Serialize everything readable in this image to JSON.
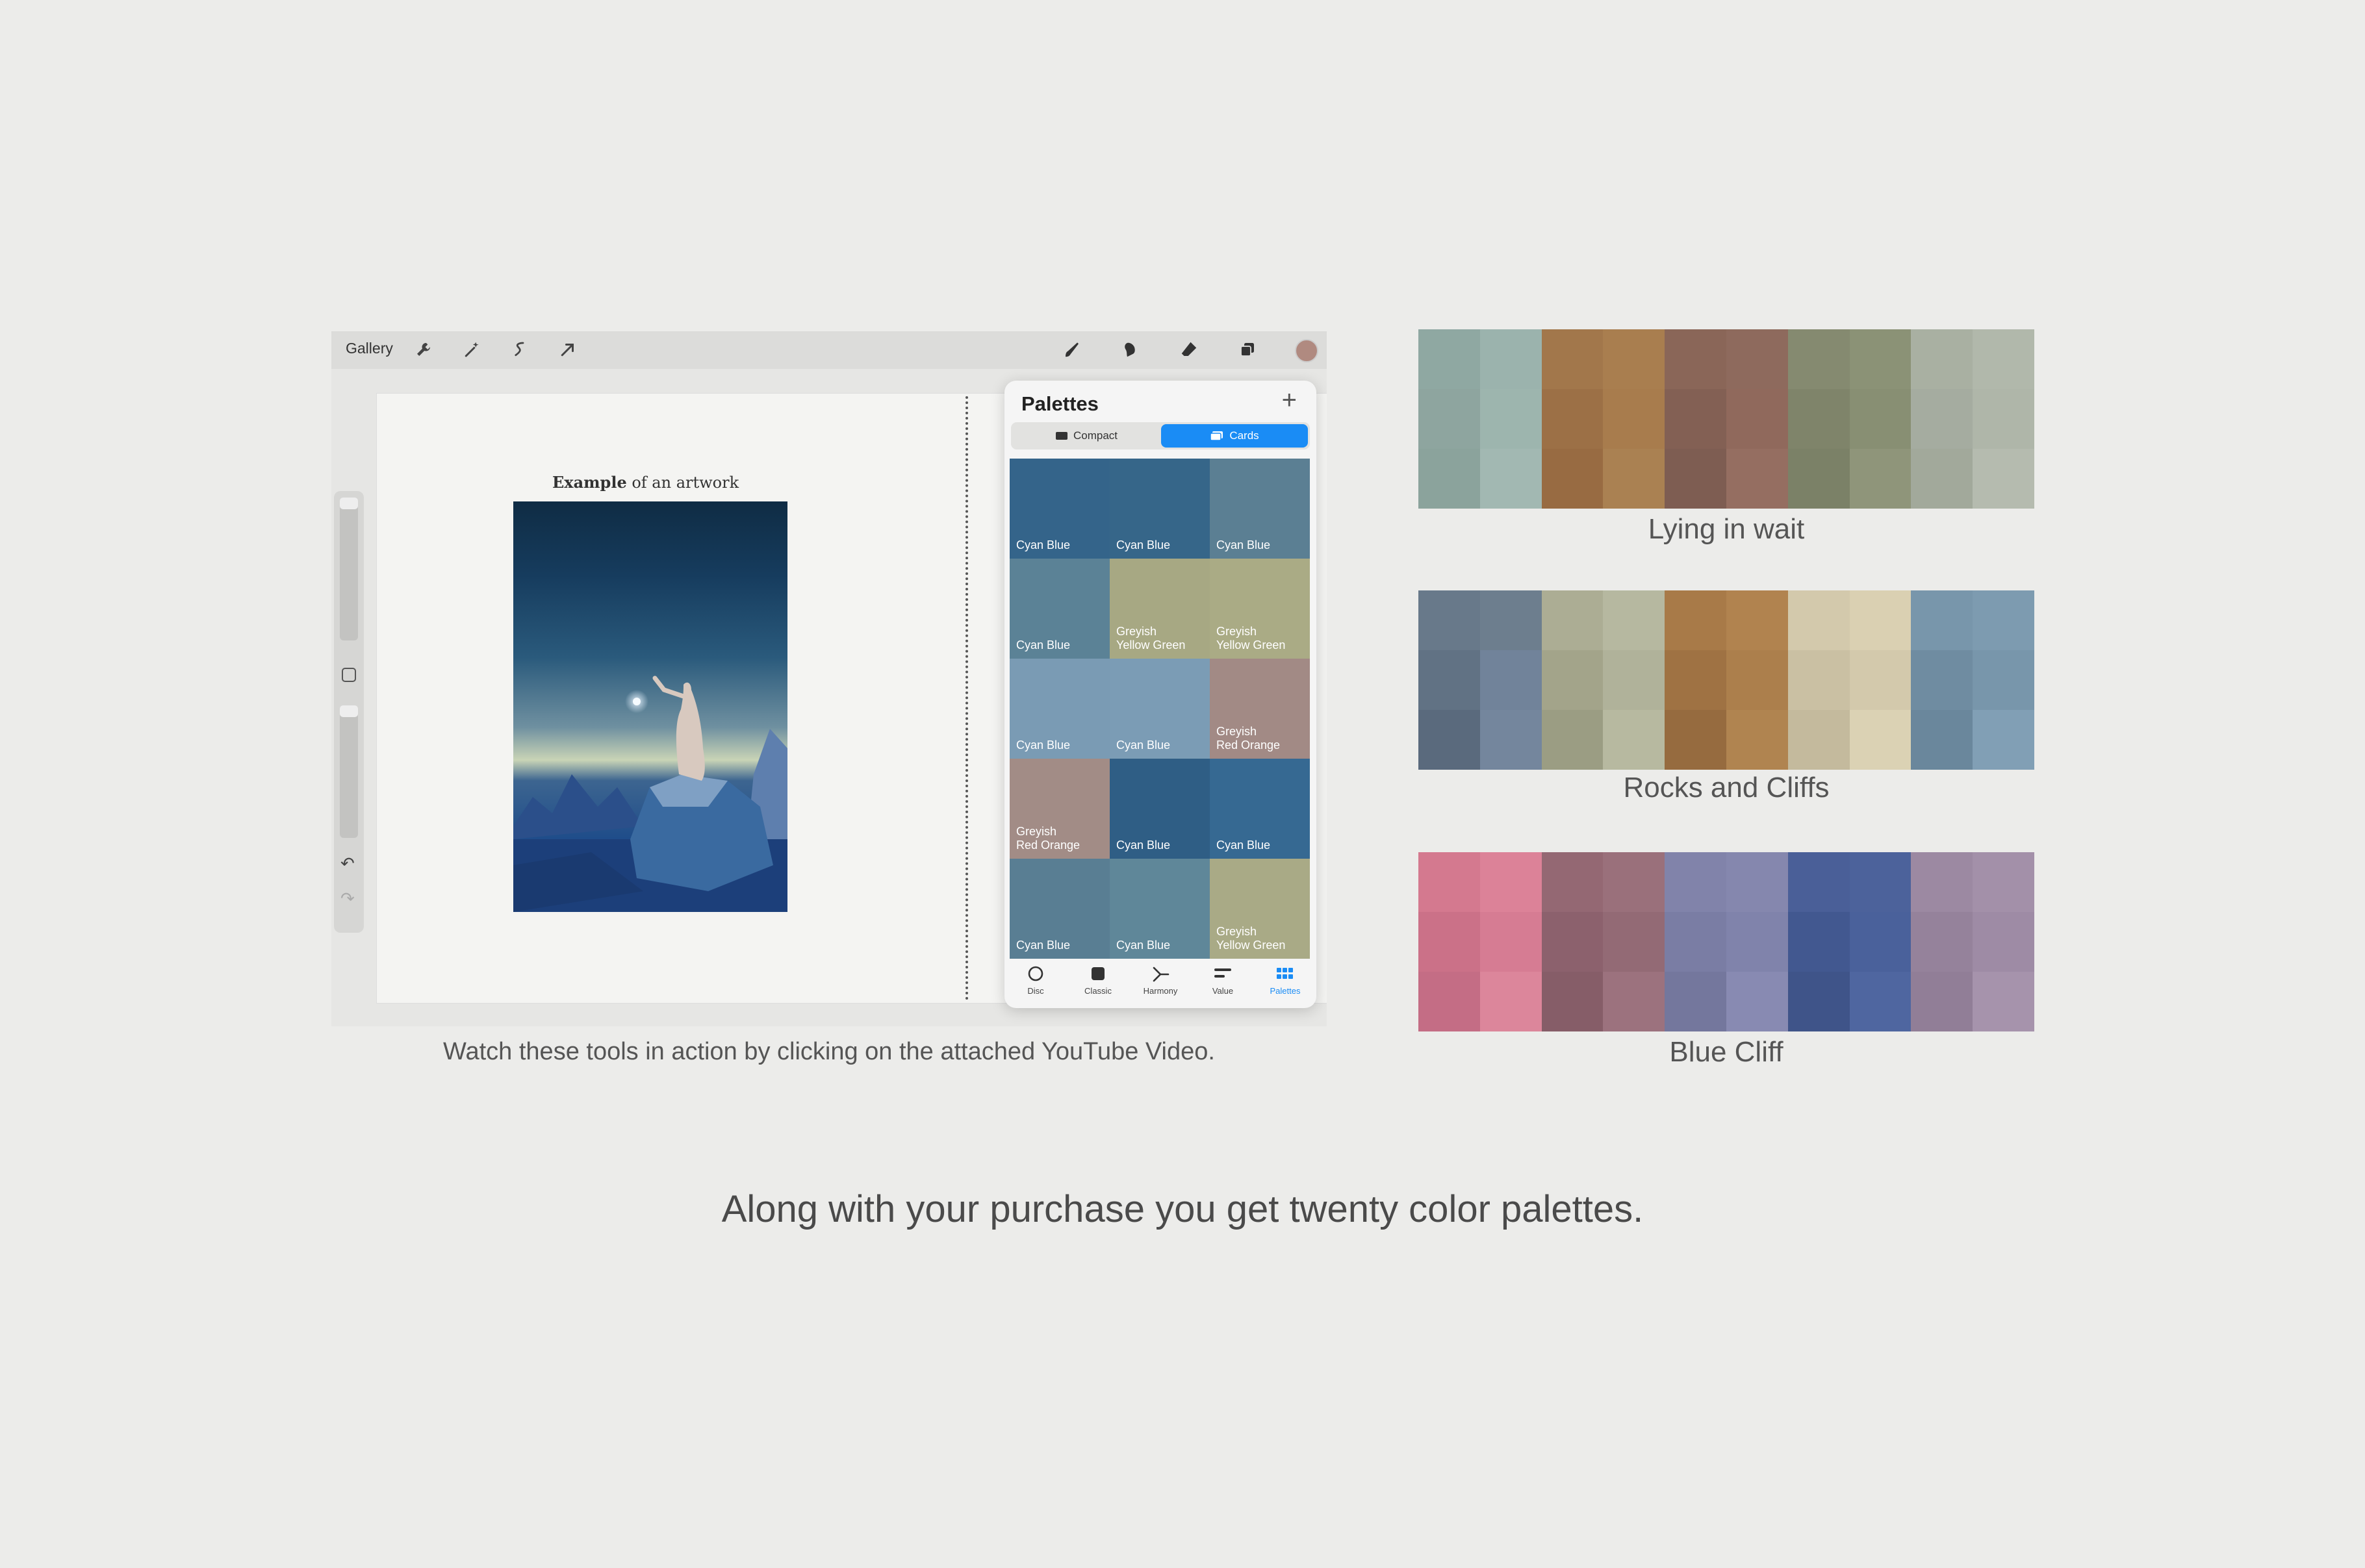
{
  "toolbar": {
    "gallery_label": "Gallery",
    "left_tools": [
      "wrench-icon",
      "magic-wand-icon",
      "selection-icon",
      "transform-arrow-icon"
    ],
    "right_tools": [
      "brush-icon",
      "smudge-icon",
      "eraser-icon",
      "layers-icon"
    ],
    "current_color": "#b08a80"
  },
  "canvas": {
    "title_bold": "Example",
    "title_rest": " of an artwork"
  },
  "palettes_panel": {
    "title": "Palettes",
    "add_icon": "+",
    "view_modes": [
      {
        "label": "Compact",
        "active": false
      },
      {
        "label": "Cards",
        "active": true
      }
    ],
    "cards": [
      {
        "label": "Cyan Blue",
        "color": "#34648a"
      },
      {
        "label": "Cyan Blue",
        "color": "#366689"
      },
      {
        "label": "Cyan Blue",
        "color": "#5b7f93"
      },
      {
        "label": "Cyan Blue",
        "color": "#5b8296"
      },
      {
        "label": "Greyish\nYellow Green",
        "color": "#a7a883"
      },
      {
        "label": "Greyish\nYellow Green",
        "color": "#aaab85"
      },
      {
        "label": "Cyan Blue",
        "color": "#7a9bb4"
      },
      {
        "label": "Cyan Blue",
        "color": "#7b9cb5"
      },
      {
        "label": "Greyish\nRed Orange",
        "color": "#a28a85"
      },
      {
        "label": "Greyish\nRed Orange",
        "color": "#a28c86"
      },
      {
        "label": "Cyan Blue",
        "color": "#2f5e85"
      },
      {
        "label": "Cyan Blue",
        "color": "#366992"
      },
      {
        "label": "Cyan Blue",
        "color": "#597e93"
      },
      {
        "label": "Cyan Blue",
        "color": "#5f8799"
      },
      {
        "label": "Greyish\nYellow Green",
        "color": "#a9aa86"
      }
    ],
    "tabs": [
      {
        "label": "Disc",
        "icon": "disc-icon",
        "active": false
      },
      {
        "label": "Classic",
        "icon": "classic-icon",
        "active": false
      },
      {
        "label": "Harmony",
        "icon": "harmony-icon",
        "active": false
      },
      {
        "label": "Value",
        "icon": "value-icon",
        "active": false
      },
      {
        "label": "Palettes",
        "icon": "palettes-grid-icon",
        "active": true
      }
    ]
  },
  "caption": "Watch these tools in action by clicking on the attached YouTube Video.",
  "palette_swatches": [
    {
      "name": "Lying in wait",
      "columns": [
        [
          "#8fa8a2",
          "#8ea59f",
          "#8ba39c"
        ],
        [
          "#9bb3ad",
          "#9db5ae",
          "#a2b8b2"
        ],
        [
          "#a2774b",
          "#9c7046",
          "#986b42"
        ],
        [
          "#a97e4f",
          "#a87c4d",
          "#aa8152"
        ],
        [
          "#8a6658",
          "#836054",
          "#7e5d52"
        ],
        [
          "#8e6a5d",
          "#90695c",
          "#956e61"
        ],
        [
          "#858a70",
          "#7f846a",
          "#7b8167"
        ],
        [
          "#8b9276",
          "#888f73",
          "#8f957a"
        ],
        [
          "#a9b0a2",
          "#a5aca0",
          "#a2a99b"
        ],
        [
          "#b1b8ab",
          "#afb6a9",
          "#b5bbaf"
        ]
      ]
    },
    {
      "name": "Rocks and Cliffs",
      "columns": [
        [
          "#68798a",
          "#617284",
          "#5a6a7d"
        ],
        [
          "#6d7e8e",
          "#71839a",
          "#74869d"
        ],
        [
          "#acad94",
          "#a3a48a",
          "#9b9d83"
        ],
        [
          "#b6b8a0",
          "#b0b29a",
          "#b7b9a0"
        ],
        [
          "#a87a48",
          "#9f7243",
          "#966b3f"
        ],
        [
          "#b1834f",
          "#ac7f4c",
          "#b08450"
        ],
        [
          "#d3c9ac",
          "#cac0a3",
          "#c4ba9d"
        ],
        [
          "#dad0b2",
          "#d3c9ac",
          "#dbd2b4"
        ],
        [
          "#7896ab",
          "#6f8ca1",
          "#6a879c"
        ],
        [
          "#7d9bb0",
          "#7896ab",
          "#819fb5"
        ]
      ]
    },
    {
      "name": "Blue Cliff",
      "columns": [
        [
          "#d4798f",
          "#cb7188",
          "#c46d85"
        ],
        [
          "#dc8298",
          "#d67c93",
          "#dc869b"
        ],
        [
          "#946873",
          "#8c616d",
          "#865d68"
        ],
        [
          "#9a707b",
          "#936a75",
          "#9c727e"
        ],
        [
          "#8183aa",
          "#7a7da4",
          "#74779d"
        ],
        [
          "#8587ae",
          "#8083ab",
          "#888ab2"
        ],
        [
          "#4a5f98",
          "#425890",
          "#3f5489"
        ],
        [
          "#4c629b",
          "#4a619b",
          "#4f66a0"
        ],
        [
          "#9c89a2",
          "#95829b",
          "#917e97"
        ],
        [
          "#a390a9",
          "#9e8ba5",
          "#a693ac"
        ]
      ]
    }
  ],
  "tagline": "Along with your purchase you get twenty color palettes."
}
